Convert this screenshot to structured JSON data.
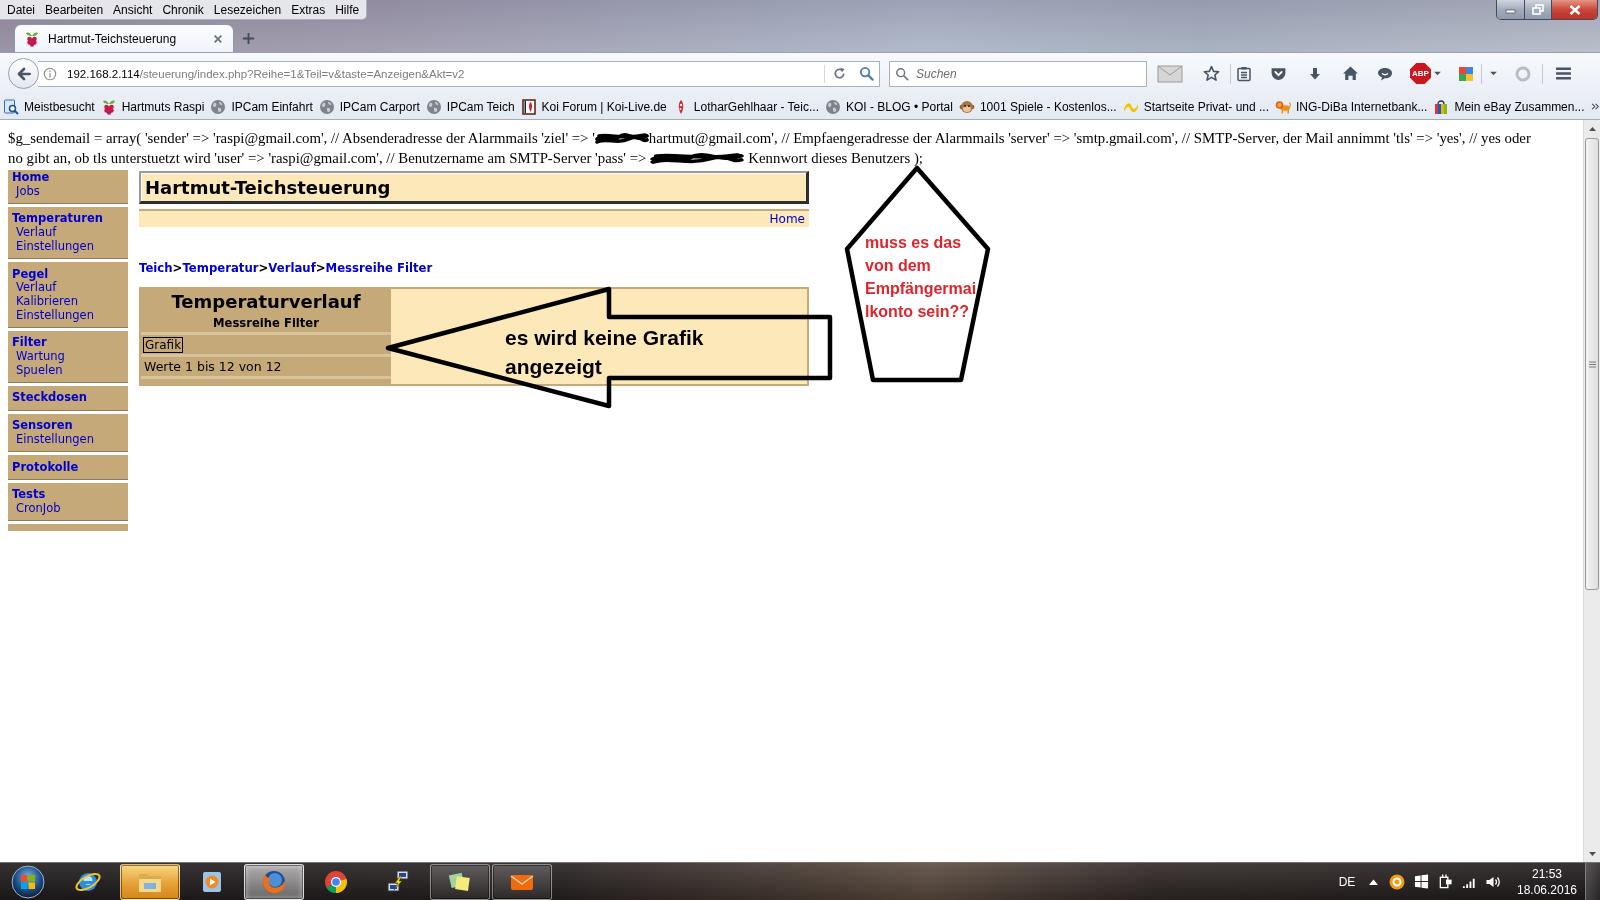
{
  "menu_bar": [
    "Datei",
    "Bearbeiten",
    "Ansicht",
    "Chronik",
    "Lesezeichen",
    "Extras",
    "Hilfe"
  ],
  "tabs": [
    {
      "title": "Hartmut-Teichsteuerung",
      "selected": true
    }
  ],
  "address_bar": {
    "host": "192.168.2.114",
    "path": "/steuerung/index.php?Reihe=1&Teil=v&taste=Anzeigen&Akt=v2"
  },
  "search": {
    "placeholder": "Suchen"
  },
  "toolbar": {
    "adblock_label": "ABP"
  },
  "bookmarks": [
    {
      "kind": "smart_folder",
      "label": "Meistbesucht"
    },
    {
      "kind": "raspberry",
      "label": "Hartmuts Raspi"
    },
    {
      "kind": "globe",
      "label": "IPCam Einfahrt"
    },
    {
      "kind": "globe",
      "label": "IPCam Carport"
    },
    {
      "kind": "globe",
      "label": "IPCam Teich"
    },
    {
      "kind": "koi_tile",
      "label": "Koi Forum | Koi-Live.de"
    },
    {
      "kind": "koi",
      "label": "LotharGehlhaar - Teic..."
    },
    {
      "kind": "globe",
      "label": "KOI - BLOG • Portal"
    },
    {
      "kind": "monkey",
      "label": "1001 Spiele - Kostenlos..."
    },
    {
      "kind": "ribbon",
      "label": "Startseite Privat- und ..."
    },
    {
      "kind": "lion",
      "label": "ING-DiBa Internetbank..."
    },
    {
      "kind": "bag",
      "label": "Mein eBay Zusammen..."
    }
  ],
  "page": {
    "config_text": [
      {
        "kind": "text",
        "text": "$g_sendemail = array( 'sender' => 'raspi@gmail.com', // Absenderadresse der Alarmmails 'ziel' => '"
      },
      {
        "kind": "redaction"
      },
      {
        "kind": "text",
        "text": "hartmut@gmail.com', // Empfaengeradresse der Alarmmails 'server' => 'smtp.gmail.com', // SMTP-Server, der Mail annimmt 'tls' => 'yes', // yes oder"
      },
      {
        "kind": "text",
        "text": "no gibt an, ob tls unterstuetzt wird 'user' => 'raspi@gmail.com', // Benutzername am SMTP-Server 'pass' =>"
      },
      {
        "kind": "redaction"
      },
      {
        "kind": "text",
        "text": "Kennwort dieses Benutzers );"
      }
    ],
    "sidebar": [
      {
        "title": "Home",
        "links": [
          "Jobs"
        ]
      },
      {
        "title": "Temperaturen",
        "links": [
          "Verlauf",
          "Einstellungen"
        ]
      },
      {
        "title": "Pegel",
        "links": [
          "Verlauf",
          "Kalibrieren",
          "Einstellungen"
        ]
      },
      {
        "title": "Filter",
        "links": [
          "Wartung",
          "Spuelen"
        ]
      },
      {
        "title": "Steckdosen"
      },
      {
        "title": "Sensoren",
        "links": [
          "Einstellungen"
        ]
      },
      {
        "title": "Protokolle"
      },
      {
        "title": "Tests",
        "links": [
          "CronJob"
        ]
      }
    ],
    "site_title": "Hartmut-Teichsteuerung",
    "top_links": [
      "Home"
    ],
    "breadcrumb": [
      {
        "label": "Teich"
      },
      {
        "separator": ">",
        "label": "Temperatur"
      },
      {
        "separator": ">",
        "label": "Verlauf"
      },
      {
        "separator": ">",
        "label": "Messreihe Filter"
      }
    ],
    "panel": {
      "title": "Temperaturverlauf",
      "subtitle": "Messreihe Filter",
      "image_alt": "Grafik",
      "range": "Werte 1 bis 12 von 12"
    }
  },
  "annotations": [
    {
      "kind": "arrow",
      "lines": [
        "es wird keine Grafik",
        "angezeigt"
      ]
    },
    {
      "kind": "pentagon",
      "lines": [
        "muss es das",
        "von dem",
        "Empfängermai",
        "lkonto sein??"
      ]
    }
  ],
  "taskbar": {
    "apps": [
      {
        "kind": "ie",
        "running": false,
        "selected": false,
        "flashing": false
      },
      {
        "kind": "explorer",
        "running": true,
        "selected": false,
        "flashing": true
      },
      {
        "kind": "media",
        "running": false,
        "selected": false,
        "flashing": false
      },
      {
        "kind": "firefox",
        "running": true,
        "selected": true,
        "flashing": false
      },
      {
        "kind": "chrome",
        "running": false,
        "selected": false,
        "flashing": false
      },
      {
        "kind": "putty",
        "running": false,
        "selected": false,
        "flashing": false
      },
      {
        "kind": "sticky",
        "running": true,
        "selected": false,
        "flashing": false
      },
      {
        "kind": "mail",
        "running": true,
        "selected": false,
        "flashing": false
      }
    ],
    "language": "DE",
    "time": "21:53",
    "date": "18.06.2016"
  }
}
